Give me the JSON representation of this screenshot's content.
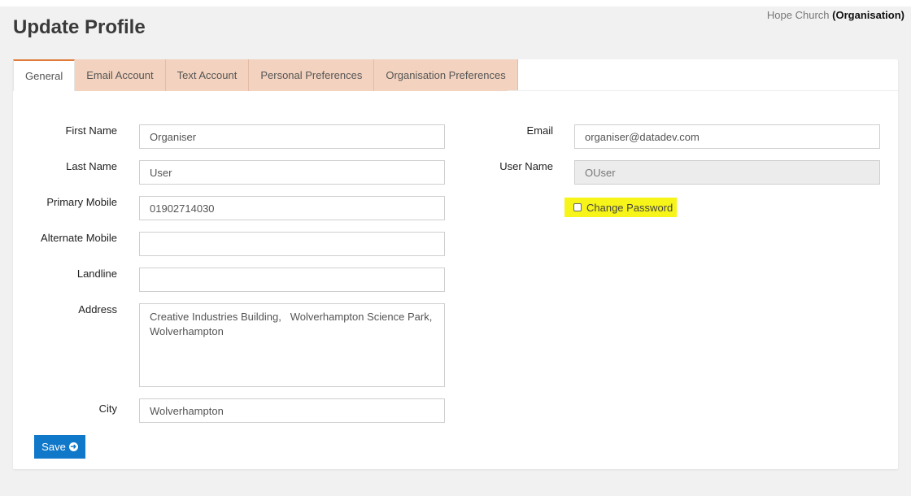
{
  "header": {
    "title": "Update Profile",
    "org_name": "Hope Church",
    "org_type": "(Organisation)"
  },
  "tabs": [
    {
      "label": "General",
      "active": true
    },
    {
      "label": "Email Account",
      "active": false
    },
    {
      "label": "Text Account",
      "active": false
    },
    {
      "label": "Personal Preferences",
      "active": false
    },
    {
      "label": "Organisation Preferences",
      "active": false
    }
  ],
  "form": {
    "first_name": {
      "label": "First Name",
      "value": "Organiser"
    },
    "last_name": {
      "label": "Last Name",
      "value": "User"
    },
    "primary_mobile": {
      "label": "Primary Mobile",
      "value": "01902714030"
    },
    "alternate_mobile": {
      "label": "Alternate Mobile",
      "value": ""
    },
    "landline": {
      "label": "Landline",
      "value": ""
    },
    "address": {
      "label": "Address",
      "value": "Creative Industries Building,   Wolverhampton Science Park, Wolverhampton"
    },
    "city": {
      "label": "City",
      "value": "Wolverhampton"
    },
    "email": {
      "label": "Email",
      "value": "organiser@datadev.com"
    },
    "user_name": {
      "label": "User Name",
      "value": "OUser"
    },
    "change_password": {
      "label": "Change Password",
      "checked": false
    }
  },
  "actions": {
    "save_label": "Save",
    "save_icon": "circle-arrow-right-icon"
  },
  "colors": {
    "tab_inactive_bg": "#f3d3bf",
    "tab_active_accent": "#e07b39",
    "save_button_bg": "#1078c9",
    "highlight": "#f6f418"
  }
}
